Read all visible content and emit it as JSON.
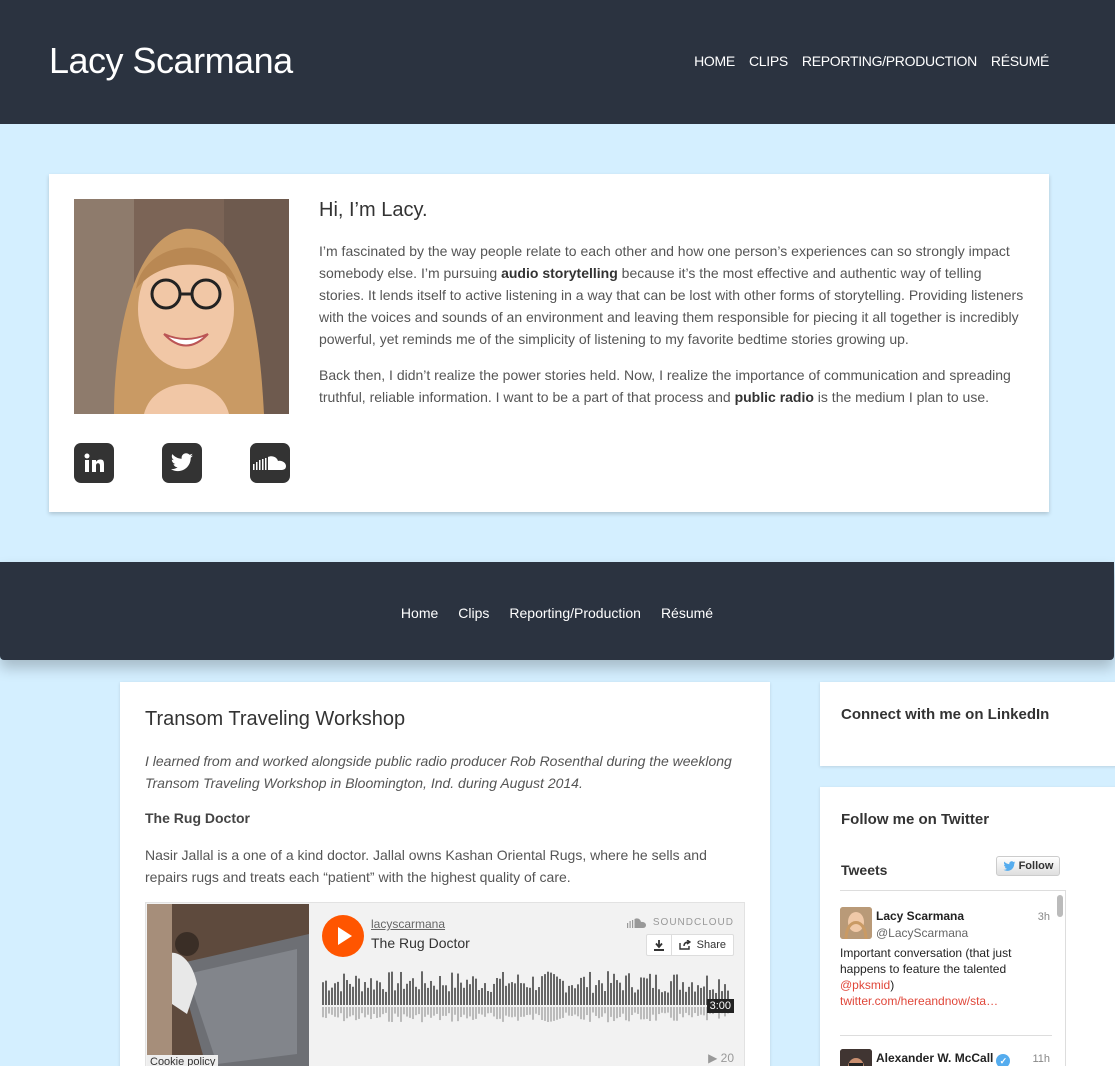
{
  "site": {
    "title": "Lacy Scarmana"
  },
  "top_nav": [
    "HOME",
    "CLIPS",
    "REPORTING/PRODUCTION",
    "RÉSUMÉ"
  ],
  "hero": {
    "heading": "Hi, I’m Lacy.",
    "p1_a": "I’m fascinated by the way people relate to each other and how one person’s experiences can so strongly impact somebody else. I’m pursuing ",
    "p1_bold": "audio storytelling",
    "p1_b": " because it’s the most effective and authentic way of telling stories. It lends itself to active listening in a way that can be lost with other forms of storytelling. Providing listeners with the voices and sounds of an environment and leaving them responsible for piecing it all together is incredibly powerful, yet reminds me of the simplicity of listening to my favorite bedtime stories growing up.",
    "p2_a": "Back then, I didn’t realize the power stories held. Now, I realize the importance of communication and spreading truthful, reliable information. I want to be a part of that process and ",
    "p2_bold": "public radio",
    "p2_b": " is the medium I plan to use.",
    "socials": [
      {
        "name": "linkedin-icon",
        "glyph": "in"
      },
      {
        "name": "twitter-icon",
        "glyph": "bird"
      },
      {
        "name": "soundcloud-icon",
        "glyph": "cloud"
      }
    ]
  },
  "nav2": [
    "Home",
    "Clips",
    "Reporting/Production",
    "Résumé"
  ],
  "post": {
    "title": "Transom Traveling Workshop",
    "intro": "I learned from and worked alongside public radio producer Rob Rosenthal during the weeklong Transom Traveling Workshop in Bloomington, Ind. during August 2014.",
    "subheading": "The Rug Doctor",
    "description": "Nasir Jallal is a one of a kind doctor. Jallal owns Kashan Oriental Rugs, where he sells and repairs rugs and treats each “patient” with the highest quality of care."
  },
  "player": {
    "uploader": "lacyscarmana",
    "track": "The Rug Doctor",
    "brand": "SOUNDCLOUD",
    "share": "Share",
    "duration": "3:00",
    "plays": "20",
    "cookie": "Cookie policy"
  },
  "sidebar": {
    "linkedin_heading": "Connect with me on LinkedIn",
    "twitter_heading": "Follow me on Twitter",
    "tweets_label": "Tweets",
    "follow_label": "Follow",
    "tweets": [
      {
        "name": "Lacy Scarmana",
        "handle": "@LacyScarmana",
        "time": "3h",
        "text_a": "Important conversation (that just happens to feature the talented ",
        "mention": "@pksmid",
        "text_b": ")",
        "link": "twitter.com/hereandnow/sta…"
      },
      {
        "name": "Alexander W. McCall",
        "time": "11h"
      }
    ]
  },
  "colors": {
    "dark": "#2b3340",
    "background": "#d4efff",
    "accent": "#ff5500",
    "twitter": "#55acee"
  }
}
